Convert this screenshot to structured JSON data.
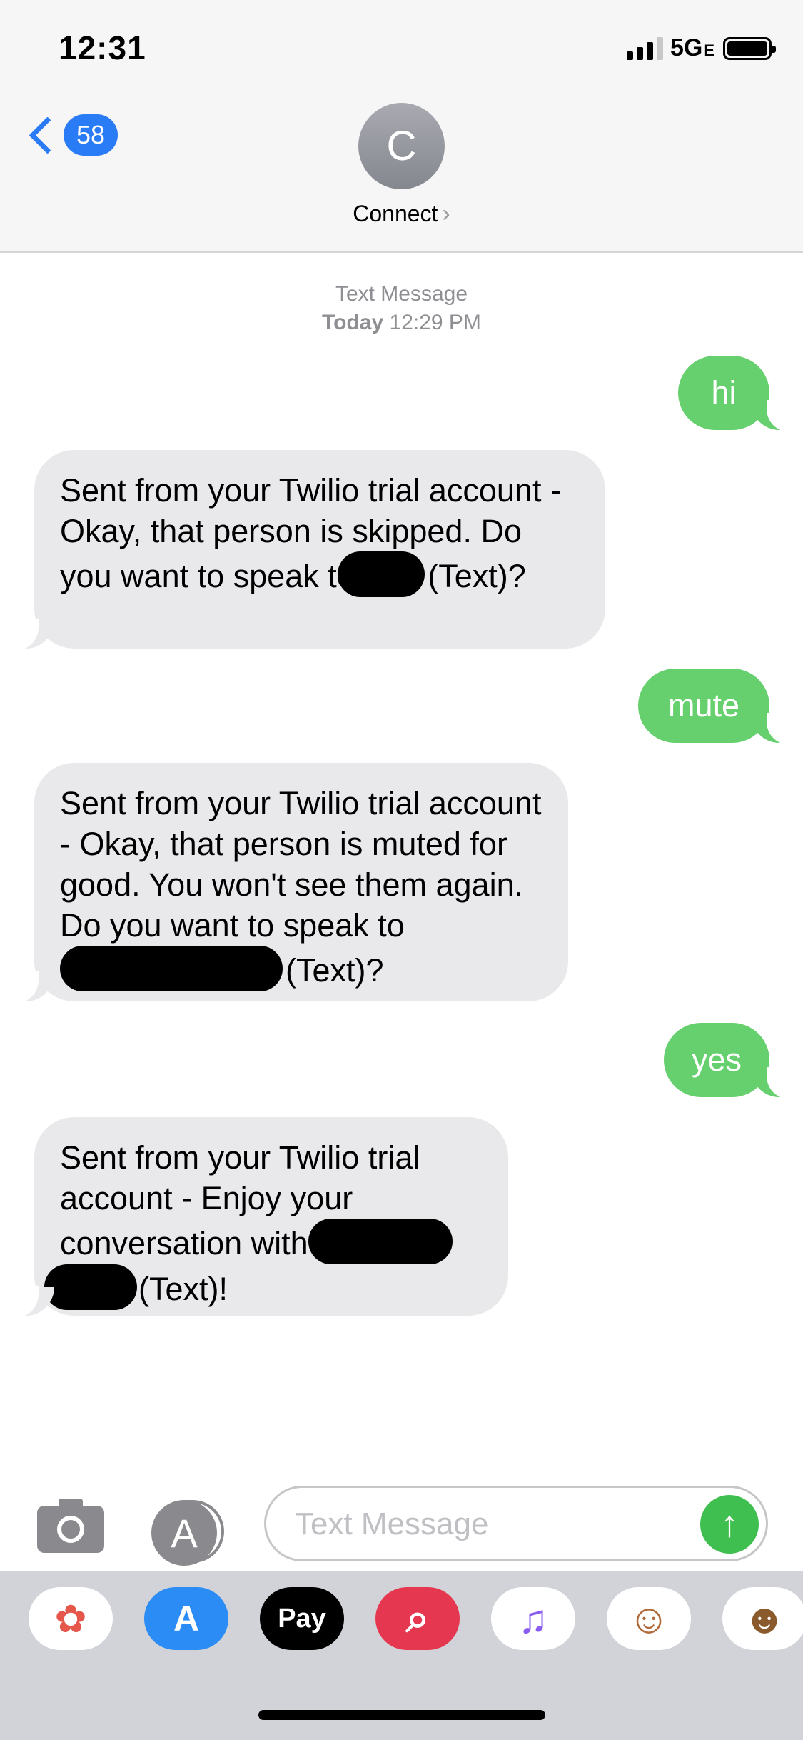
{
  "status_bar": {
    "time": "12:31",
    "network": "5G",
    "network_suffix": "E"
  },
  "header": {
    "back_count": "58",
    "avatar_initial": "C",
    "contact_name": "Connect",
    "contact_chevron": "›"
  },
  "thread": {
    "timestamp_label": "Text Message",
    "timestamp_day": "Today",
    "timestamp_time": "12:29 PM",
    "messages": [
      {
        "direction": "outgoing",
        "text": "hi"
      },
      {
        "direction": "incoming",
        "text_a": "Sent from your Twilio trial account - Okay, that person is skipped. Do you want to speak to ",
        "text_b": "(Text)?"
      },
      {
        "direction": "outgoing",
        "text": "mute"
      },
      {
        "direction": "incoming",
        "text_a": "Sent from your Twilio trial account - Okay, that person is muted for good. You won't see them again. Do you want to speak to ",
        "text_b": "(Text)?"
      },
      {
        "direction": "outgoing",
        "text": "yes"
      },
      {
        "direction": "incoming",
        "text_a": "Sent from your Twilio trial account - Enjoy your conversation with",
        "text_b": "(Text)!"
      }
    ]
  },
  "composer": {
    "placeholder": "Text Message",
    "send_glyph": "↑",
    "apps_glyph": "A"
  },
  "app_drawer": {
    "apps": [
      {
        "name": "photos",
        "glyph": "✿"
      },
      {
        "name": "app-store",
        "glyph": "A"
      },
      {
        "name": "apple-pay",
        "glyph": "Pay"
      },
      {
        "name": "web-search",
        "glyph": "⌕"
      },
      {
        "name": "music",
        "glyph": "♫"
      },
      {
        "name": "memoji",
        "glyph": "☺"
      },
      {
        "name": "animoji",
        "glyph": "☻"
      }
    ]
  },
  "colors": {
    "accent": "#2a7bf6",
    "outgoing_bubble": "#65d06d",
    "incoming_bubble": "#e9e9eb"
  }
}
